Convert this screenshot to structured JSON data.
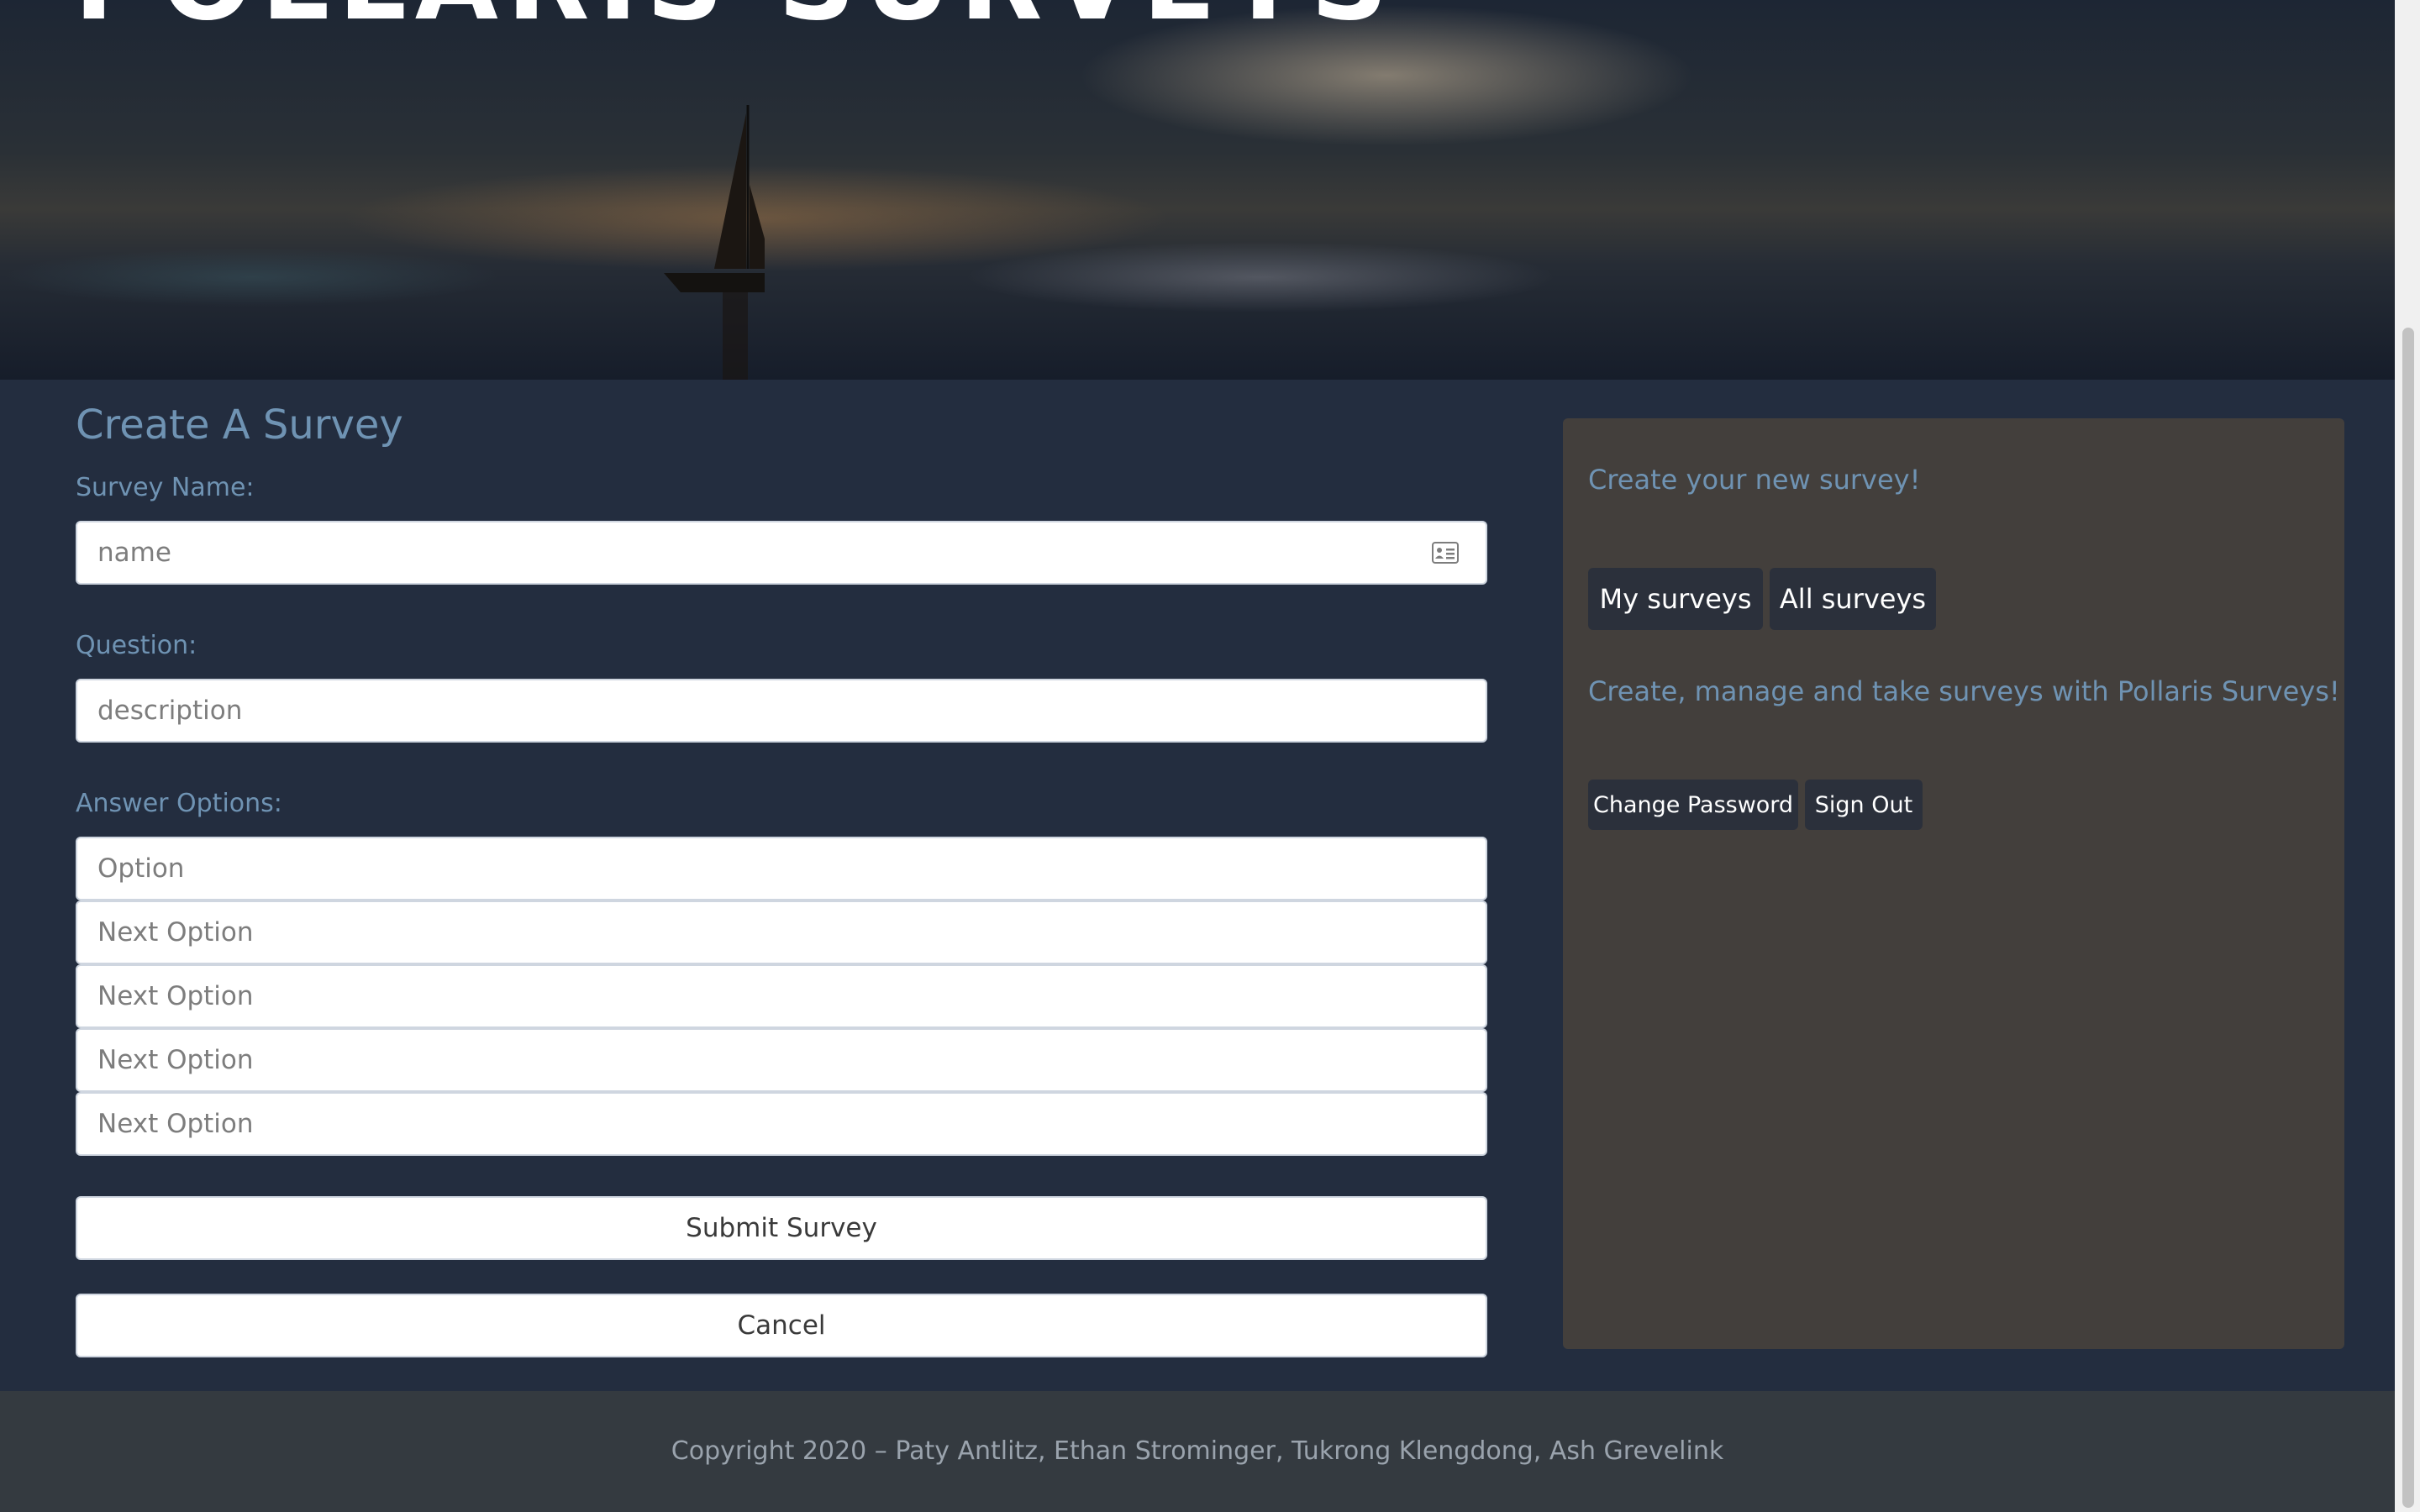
{
  "hero": {
    "title": "POLLARIS SURVEYS"
  },
  "form": {
    "title": "Create A Survey",
    "survey_name_label": "Survey Name:",
    "survey_name_placeholder": "name",
    "question_label": "Question:",
    "question_placeholder": "description",
    "answer_options_label": "Answer Options:",
    "option_placeholders": [
      "Option",
      "Next Option",
      "Next Option",
      "Next Option",
      "Next Option"
    ],
    "submit_label": "Submit Survey",
    "cancel_label": "Cancel",
    "name_field_icon": "contact-card-icon"
  },
  "panel": {
    "heading": "Create your new survey!",
    "my_surveys_label": "My surveys",
    "all_surveys_label": "All surveys",
    "tagline": "Create, manage and take surveys with Pollaris Surveys!",
    "change_password_label": "Change Password",
    "sign_out_label": "Sign Out"
  },
  "footer": {
    "copyright": "Copyright 2020 – Paty Antlitz, Ethan Strominger, Tukrong Klengdong, Ash Grevelink"
  },
  "colors": {
    "page_bg": "#232d3f",
    "label_text": "#6f93b3",
    "panel_bg": "#433f3c",
    "dark_button": "#2b303b",
    "footer_bg": "#343a40"
  }
}
